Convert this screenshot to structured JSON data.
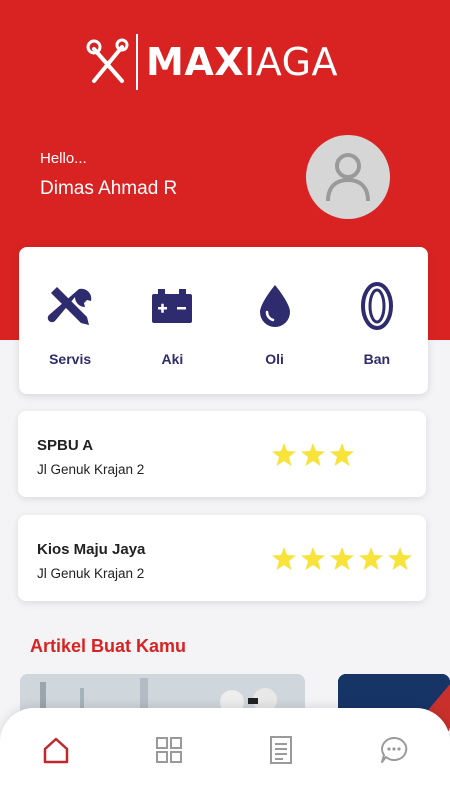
{
  "app": {
    "logo_text_bold": "MAX",
    "logo_text_rest": "IAGA",
    "primary_color": "#d92323",
    "accent_color": "#2e2b6e",
    "star_color": "#f7e33a"
  },
  "greeting": {
    "hello": "Hello...",
    "username": "Dimas Ahmad R"
  },
  "menu": {
    "items": [
      {
        "label": "Servis",
        "icon": "wrench-screwdriver-icon"
      },
      {
        "label": "Aki",
        "icon": "battery-icon"
      },
      {
        "label": "Oli",
        "icon": "oil-drop-icon"
      },
      {
        "label": "Ban",
        "icon": "tire-icon"
      }
    ]
  },
  "shops": [
    {
      "name": "SPBU A",
      "address": "Jl Genuk Krajan 2",
      "rating": 3
    },
    {
      "name": "Kios Maju Jaya",
      "address": "Jl Genuk Krajan 2",
      "rating": 5
    }
  ],
  "articles": {
    "title": "Artikel Buat Kamu"
  },
  "bottom_nav": {
    "items": [
      {
        "icon": "home-icon",
        "active": true
      },
      {
        "icon": "grid-icon",
        "active": false
      },
      {
        "icon": "document-icon",
        "active": false
      },
      {
        "icon": "chat-icon",
        "active": false
      }
    ]
  }
}
